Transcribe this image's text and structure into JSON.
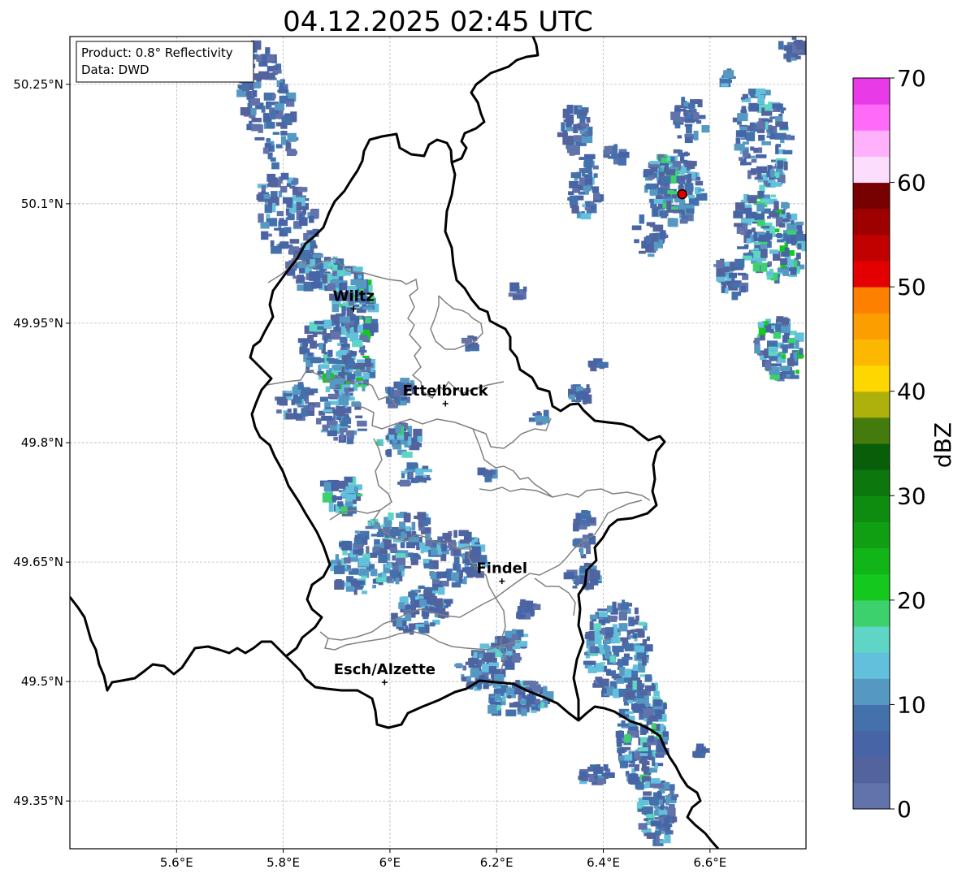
{
  "title": "04.12.2025 02:45 UTC",
  "info": {
    "product": "Product: 0.8° Reflectivity",
    "data": "Data: DWD"
  },
  "map": {
    "lon_range": [
      5.4,
      6.78
    ],
    "lat_range": [
      49.29,
      50.31
    ],
    "lon_ticks": [
      {
        "value": 5.6,
        "label": "5.6°E"
      },
      {
        "value": 5.8,
        "label": "5.8°E"
      },
      {
        "value": 6.0,
        "label": "6°E"
      },
      {
        "value": 6.2,
        "label": "6.2°E"
      },
      {
        "value": 6.4,
        "label": "6.4°E"
      },
      {
        "value": 6.6,
        "label": "6.6°E"
      }
    ],
    "lat_ticks": [
      {
        "value": 50.25,
        "label": "50.25°N"
      },
      {
        "value": 50.1,
        "label": "50.1°N"
      },
      {
        "value": 49.95,
        "label": "49.95°N"
      },
      {
        "value": 49.8,
        "label": "49.8°N"
      },
      {
        "value": 49.65,
        "label": "49.65°N"
      },
      {
        "value": 49.5,
        "label": "49.5°N"
      },
      {
        "value": 49.35,
        "label": "49.35°N"
      }
    ],
    "grid": true,
    "radar_site": {
      "lon": 6.548,
      "lat": 50.112,
      "color": "#e00000"
    },
    "cities": [
      {
        "name": "Wiltz",
        "lon": 5.932,
        "lat": 49.968
      },
      {
        "name": "Ettelbruck",
        "lon": 6.104,
        "lat": 49.849
      },
      {
        "name": "Findel",
        "lon": 6.21,
        "lat": 49.626
      },
      {
        "name": "Esch/Alzette",
        "lon": 5.99,
        "lat": 49.499
      }
    ]
  },
  "colorbar": {
    "label": "dBZ",
    "min": 0,
    "max": 70,
    "ticks": [
      "0",
      "10",
      "20",
      "30",
      "40",
      "50",
      "60",
      "70"
    ],
    "colors": [
      "#6273ab",
      "#52639e",
      "#4664a6",
      "#4471ac",
      "#5599c3",
      "#63c0dc",
      "#5ed5c5",
      "#3dd16d",
      "#14c81e",
      "#12b517",
      "#109f12",
      "#0d8c0f",
      "#0b770c",
      "#095f09",
      "#457b0c",
      "#aeb10b",
      "#fed700",
      "#fcb700",
      "#fd9e00",
      "#fd8000",
      "#e40000",
      "#c10000",
      "#9e0000",
      "#770000",
      "#fdddfd",
      "#ffb1fc",
      "#ff6af9",
      "#e93ae7"
    ]
  }
}
